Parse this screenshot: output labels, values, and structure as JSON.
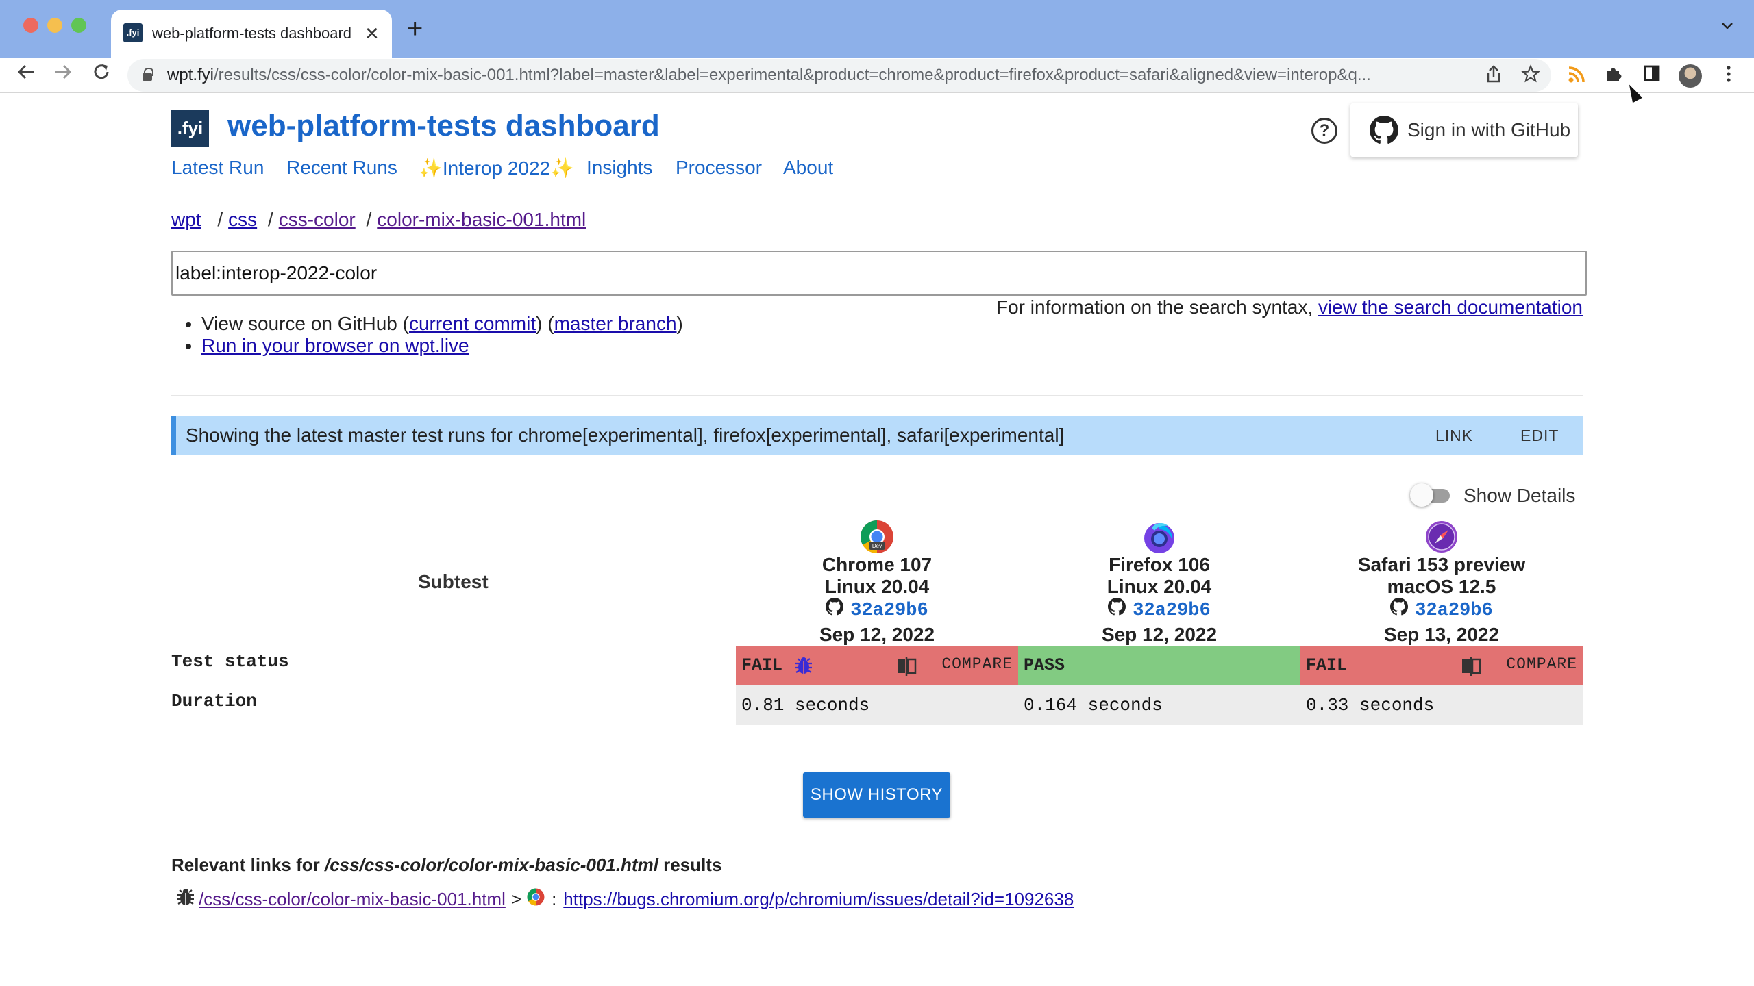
{
  "browser": {
    "tab_title": "web-platform-tests dashboard",
    "tab_favicon": ".fyi",
    "tab_close": "✕",
    "new_tab": "+",
    "url_host": "wpt.fyi",
    "url_path": "/results/css/css-color/color-mix-basic-001.html?label=master&label=experimental&product=chrome&product=firefox&product=safari&aligned&view=interop&q..."
  },
  "header": {
    "logo_text": ".fyi",
    "title": "web-platform-tests dashboard",
    "help": "?",
    "signin_label": "Sign in with GitHub"
  },
  "nav": [
    "Latest Run",
    "Recent Runs",
    "✨Interop 2022✨",
    "Insights",
    "Processor",
    "About"
  ],
  "breadcrumb": {
    "root": "wpt",
    "parts": [
      "css",
      "css-color",
      "color-mix-basic-001.html"
    ],
    "sep": "/"
  },
  "search": {
    "value": "label:interop-2022-color",
    "help_text": "For information on the search syntax,",
    "help_link": "view the search documentation"
  },
  "source": {
    "prefix": "View source on GitHub (",
    "current_commit": "current commit",
    "middle": ") (",
    "master_branch": "master branch",
    "suffix": ")",
    "run_link": "Run in your browser on wpt.live"
  },
  "banner": {
    "message": "Showing the latest master test runs for chrome[experimental], firefox[experimental], safari[experimental]",
    "link": "LINK",
    "edit": "EDIT"
  },
  "show_details": {
    "label": "Show Details",
    "on": false
  },
  "table": {
    "subtest_header": "Subtest",
    "row_labels": {
      "status": "Test status",
      "duration": "Duration"
    },
    "compare_label": "COMPARE",
    "runs": [
      {
        "browser": "Chrome 107",
        "os": "Linux 20.04",
        "sha": "32a29b6",
        "date": "Sep 12, 2022",
        "status": "FAIL",
        "duration": "0.81 seconds"
      },
      {
        "browser": "Firefox 106",
        "os": "Linux 20.04",
        "sha": "32a29b6",
        "date": "Sep 12, 2022",
        "status": "PASS",
        "duration": "0.164 seconds"
      },
      {
        "browser": "Safari 153 preview",
        "os": "macOS 12.5",
        "sha": "32a29b6",
        "date": "Sep 13, 2022",
        "status": "FAIL",
        "duration": "0.33 seconds"
      }
    ]
  },
  "history_button": "SHOW HISTORY",
  "relevant_links": {
    "prefix": "Relevant links for ",
    "path": "/css/css-color/color-mix-basic-001.html",
    "suffix": " results",
    "test_link": "/css/css-color/color-mix-basic-001.html",
    "arrow": ">",
    "colon": ":",
    "bug_url": "https://bugs.chromium.org/p/chromium/issues/detail?id=1092638"
  },
  "colors": {
    "fail": "#e27272",
    "pass": "#82cb82",
    "link": "#1a66c9",
    "banner": "#b8dcfb"
  }
}
